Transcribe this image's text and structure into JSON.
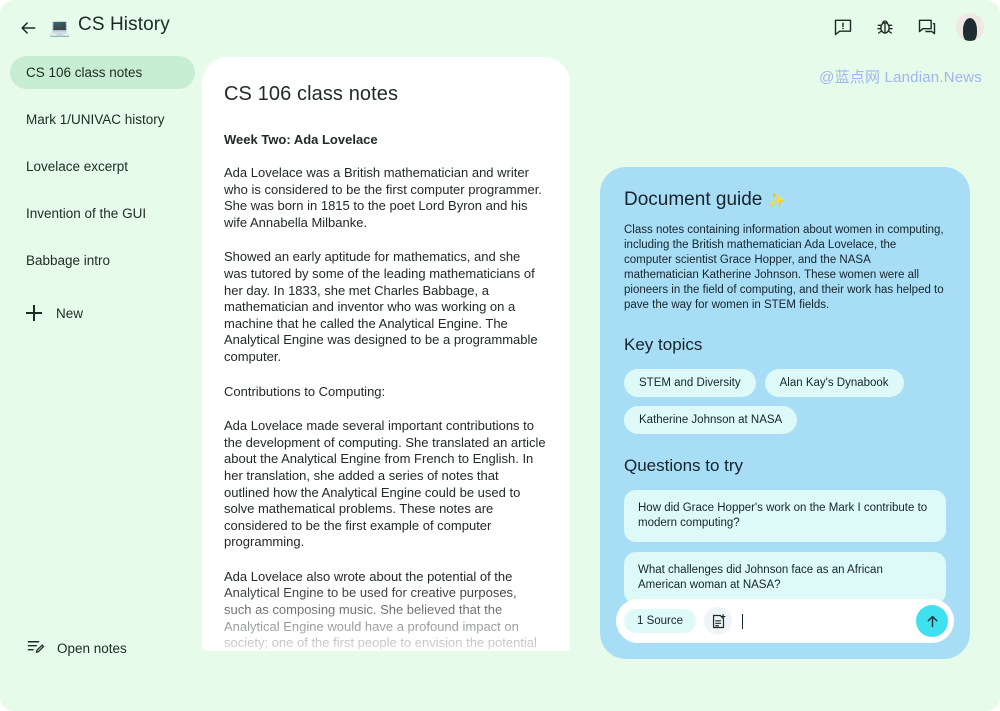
{
  "header": {
    "back_icon": "back-arrow-icon",
    "app_emoji": "💻",
    "title": "CS History",
    "icons": [
      {
        "name": "feedback-icon"
      },
      {
        "name": "bug-report-icon"
      },
      {
        "name": "chat-icon"
      }
    ],
    "avatar_label": "account-avatar"
  },
  "watermark": "@蓝点网 Landian.News",
  "sidebar": {
    "items": [
      {
        "label": "CS 106 class notes",
        "selected": true
      },
      {
        "label": "Mark 1/UNIVAC history",
        "selected": false
      },
      {
        "label": "Lovelace excerpt",
        "selected": false
      },
      {
        "label": "Invention of the GUI",
        "selected": false
      },
      {
        "label": "Babbage intro",
        "selected": false
      }
    ],
    "new_label": "New",
    "open_notes_label": "Open notes"
  },
  "document": {
    "title": "CS 106 class notes",
    "subtitle": "Week Two: Ada Lovelace",
    "paragraphs": [
      "Ada Lovelace was a British mathematician and writer who is considered to be the first computer programmer. She was born in 1815 to the poet Lord Byron and his wife Annabella Milbanke.",
      "Showed an early aptitude for mathematics, and she was tutored by some of the leading mathematicians of her day. In 1833, she met Charles Babbage, a mathematician and inventor who was working on a machine that he called the Analytical Engine. The Analytical Engine was designed to be a programmable computer.",
      "Contributions to Computing:",
      "Ada Lovelace made several important contributions to the development of computing. She translated an article about the Analytical Engine from French to English. In her translation, she added a series of notes that outlined how the Analytical Engine could be used to solve mathematical problems. These notes are considered to be the first example of computer programming.",
      "Ada Lovelace also wrote about the potential of the Analytical Engine to be used for creative purposes, such as composing music. She believed that the Analytical Engine would have a profound impact on society; one of the first people to envision the potential of computers to be used for more than just calculation."
    ]
  },
  "guide": {
    "title": "Document guide",
    "sparkle": "✨",
    "summary": "Class notes containing information about women in computing, including the British mathematician Ada Lovelace, the computer scientist Grace Hopper, and the NASA mathematician Katherine Johnson. These women were all pioneers in the field of computing, and their work has helped to pave the way for women in STEM fields.",
    "key_topics_heading": "Key topics",
    "key_topics": [
      "STEM and Diversity",
      "Alan Kay's Dynabook",
      "Katherine Johnson at NASA"
    ],
    "questions_heading": "Questions to try",
    "questions": [
      "How did Grace Hopper's work on the Mark I contribute to modern computing?",
      "What challenges did Johnson face as an African American woman at NASA?"
    ]
  },
  "composer": {
    "source_chip": "1 Source",
    "note_icon": "add-note-icon",
    "input_value": "",
    "input_placeholder": "",
    "send_icon": "send-arrow-up-icon"
  },
  "colors": {
    "page_background": "#e6fbe9",
    "guide_panel": "#a8ddf6",
    "chip": "#ddfaf9",
    "selected_nav": "#c7eed2",
    "send_button": "#3fe0f0",
    "watermark": "#9fb6f0"
  }
}
